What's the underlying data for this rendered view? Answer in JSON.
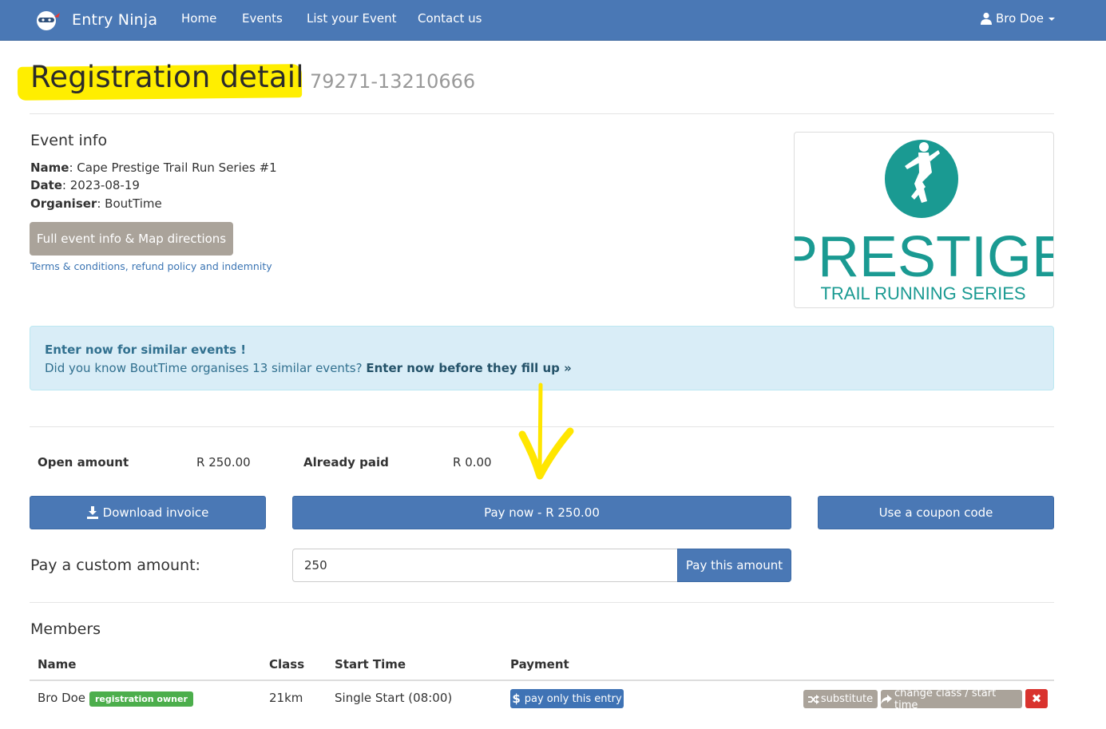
{
  "navbar": {
    "brand": "Entry Ninja",
    "links": [
      "Home",
      "Events",
      "List your Event",
      "Contact us"
    ],
    "user": "Bro Doe"
  },
  "header": {
    "title": "Registration detail",
    "reference": "79271-13210666"
  },
  "event_info": {
    "heading": "Event info",
    "name_label": "Name",
    "name": ": Cape Prestige Trail Run Series #1",
    "date_label": "Date",
    "date": ": 2023-08-19",
    "organiser_label": "Organiser",
    "organiser": ": BoutTime",
    "full_info_button": "Full event info & Map directions",
    "terms_link": "Terms & conditions, refund policy and indemnity",
    "logo": {
      "word": "PRESTIGE",
      "tagline": "TRAIL RUNNING SERIES",
      "color": "#1a9a92"
    }
  },
  "alert": {
    "title": "Enter now for similar events !",
    "text": "Did you know BoutTime organises 13 similar events?",
    "cta": "Enter now before they fill up »"
  },
  "payment": {
    "open_amount_label": "Open amount",
    "open_amount": "R 250.00",
    "already_paid_label": "Already paid",
    "already_paid": "R 0.00",
    "download_invoice": "Download invoice",
    "pay_now": "Pay now - R 250.00",
    "coupon": "Use a coupon code",
    "custom_label": "Pay a custom amount:",
    "custom_value": "250",
    "pay_this_amount": "Pay this amount"
  },
  "members": {
    "heading": "Members",
    "columns": [
      "Name",
      "Class",
      "Start Time",
      "Payment"
    ],
    "rows": [
      {
        "name": "Bro Doe",
        "badge": "registration owner",
        "class": "21km",
        "start_time": "Single Start (08:00)",
        "pay_button": "pay only this entry",
        "substitute": "substitute",
        "change_class": "change class / start time"
      }
    ]
  },
  "colors": {
    "primary": "#4a78b5",
    "muted_button": "#aaa39a",
    "alert_bg": "#d9edf7",
    "highlight": "#ffee00",
    "success": "#4cae4c",
    "danger": "#d9332e"
  }
}
